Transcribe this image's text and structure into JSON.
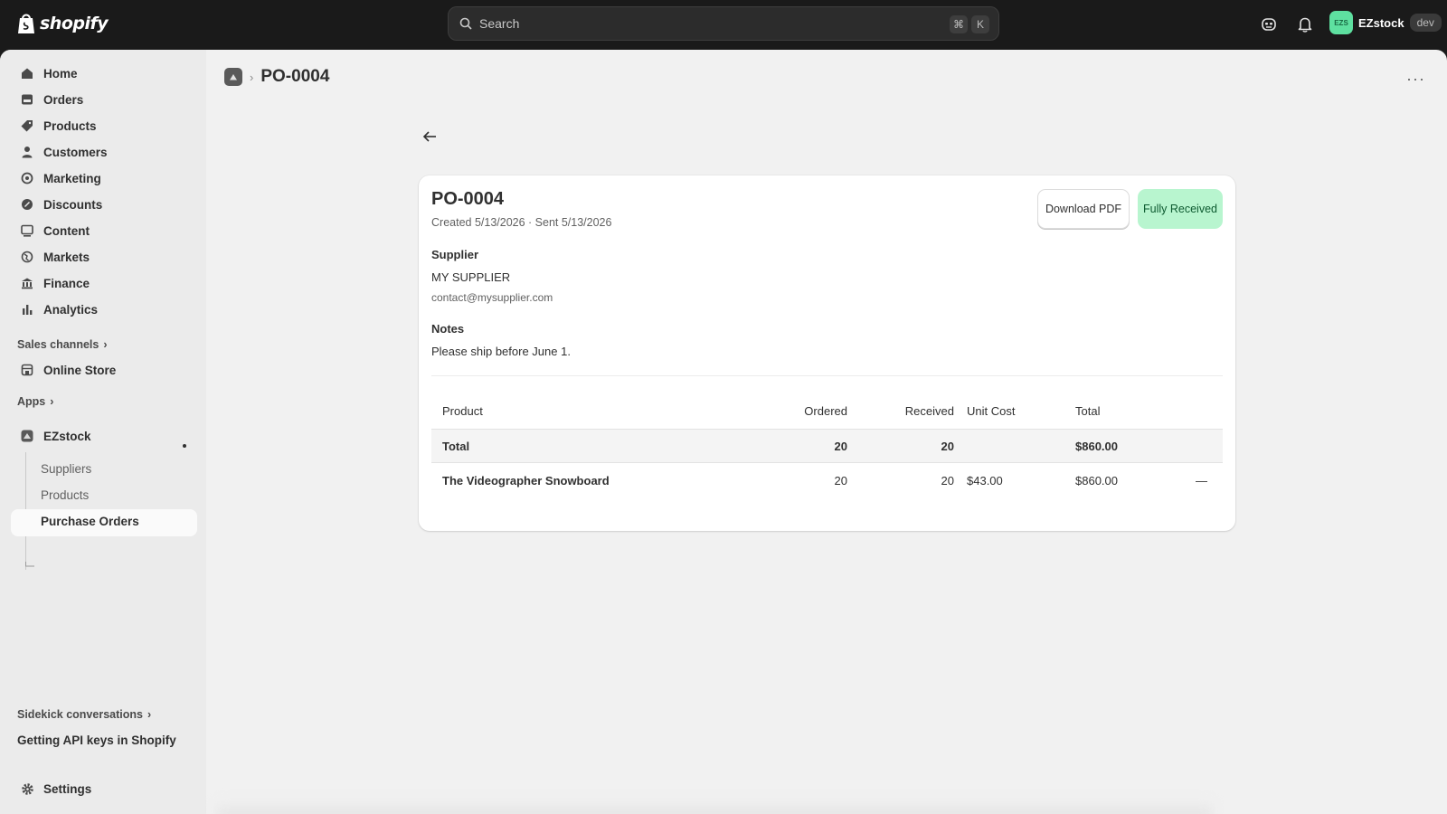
{
  "topbar": {
    "brand": "shopify",
    "search_placeholder": "Search",
    "shortcut_keys": [
      "⌘",
      "K"
    ],
    "store_avatar_text": "EZS",
    "store_name": "EZstock",
    "env_badge": "dev"
  },
  "sidebar": {
    "nav": [
      {
        "label": "Home",
        "icon": "home-icon"
      },
      {
        "label": "Orders",
        "icon": "orders-icon"
      },
      {
        "label": "Products",
        "icon": "tag-icon"
      },
      {
        "label": "Customers",
        "icon": "person-icon"
      },
      {
        "label": "Marketing",
        "icon": "target-icon"
      },
      {
        "label": "Discounts",
        "icon": "discount-icon"
      },
      {
        "label": "Content",
        "icon": "content-icon"
      },
      {
        "label": "Markets",
        "icon": "globe-icon"
      },
      {
        "label": "Finance",
        "icon": "bank-icon"
      },
      {
        "label": "Analytics",
        "icon": "bar-chart-icon"
      }
    ],
    "sales_channels_label": "Sales channels",
    "online_store_label": "Online Store",
    "apps_label": "Apps",
    "app_name": "EZstock",
    "app_sub_items": [
      "Suppliers",
      "Products",
      "Purchase Orders"
    ],
    "sidekick_label": "Sidekick conversations",
    "sidekick_item": "Getting API keys in Shopify",
    "settings_label": "Settings"
  },
  "page": {
    "breadcrumb_title": "PO-0004"
  },
  "po": {
    "title": "PO-0004",
    "meta": "Created 5/13/2026 · Sent 5/13/2026",
    "download_label": "Download PDF",
    "status": "Fully Received",
    "supplier_label": "Supplier",
    "supplier_name": "MY SUPPLIER",
    "supplier_email": "contact@mysupplier.com",
    "notes_label": "Notes",
    "notes": "Please ship before June 1.",
    "table": {
      "headers": {
        "product": "Product",
        "ordered": "Ordered",
        "received": "Received",
        "unit_cost": "Unit Cost",
        "total": "Total"
      },
      "total_row": {
        "product": "Total",
        "ordered": "20",
        "received": "20",
        "unit_cost": "",
        "total": "$860.00"
      },
      "rows": [
        {
          "product": "The Videographer Snowboard",
          "ordered": "20",
          "received": "20",
          "unit_cost": "$43.00",
          "total": "$860.00",
          "action": "—"
        }
      ]
    }
  },
  "colors": {
    "topbar_bg": "#1a1a1a",
    "status_bg": "#b8f5cf",
    "status_text": "#0d5a30"
  }
}
